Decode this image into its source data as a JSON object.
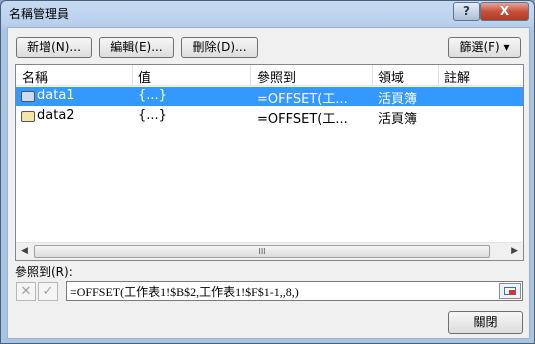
{
  "dialog": {
    "title": "名稱管理員",
    "help_label": "?",
    "close_label": "X"
  },
  "toolbar": {
    "new_label": "新增(N)...",
    "edit_label": "編輯(E)...",
    "delete_label": "刪除(D)...",
    "filter_label": "篩選(F) ▾"
  },
  "table": {
    "columns": [
      "名稱",
      "值",
      "參照到",
      "領域",
      "註解"
    ],
    "rows": [
      {
        "name": "data1",
        "value": "{...}",
        "refers_to": "=OFFSET(工...",
        "scope": "活頁簿",
        "comment": "",
        "selected": true
      },
      {
        "name": "data2",
        "value": "{...}",
        "refers_to": "=OFFSET(工...",
        "scope": "活頁簿",
        "comment": "",
        "selected": false
      }
    ],
    "scroll_left": "◀",
    "scroll_right": "▶",
    "scroll_grip": "III"
  },
  "refers": {
    "label": "參照到(R):",
    "cancel_icon": "✕",
    "confirm_icon": "✓",
    "value": "=OFFSET(工作表1!$B$2,工作表1!$F$1-1,,8,)"
  },
  "footer": {
    "close_label": "關閉"
  }
}
